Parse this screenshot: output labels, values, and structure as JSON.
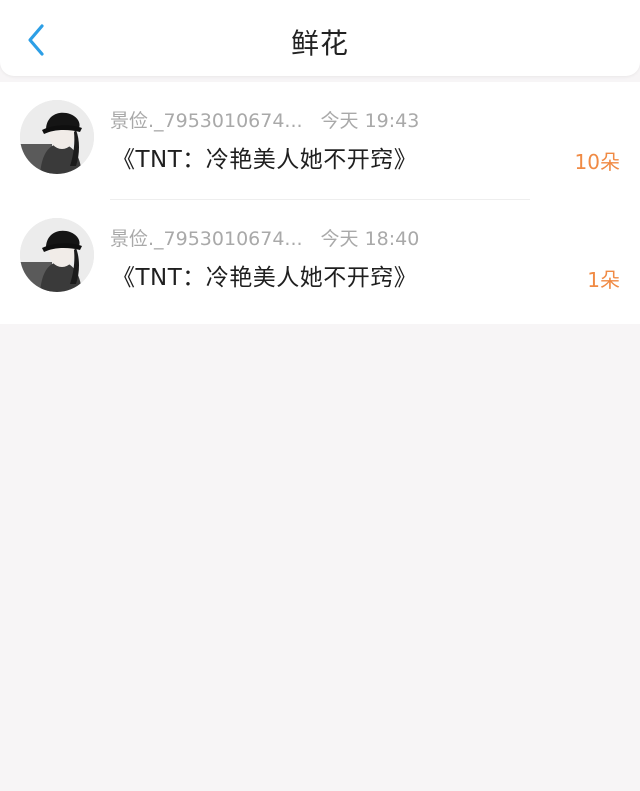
{
  "header": {
    "title": "鲜花"
  },
  "colors": {
    "accent_blue": "#2d9fe6",
    "count_orange": "#f08a44",
    "meta_gray": "#a9a9a9"
  },
  "items": [
    {
      "username": "景俭._7953010674...",
      "time": "今天 19:43",
      "book": "《TNT：冷艳美人她不开窍》",
      "count": "10朵"
    },
    {
      "username": "景俭._7953010674...",
      "time": "今天 18:40",
      "book": "《TNT：冷艳美人她不开窍》",
      "count": "1朵"
    }
  ]
}
